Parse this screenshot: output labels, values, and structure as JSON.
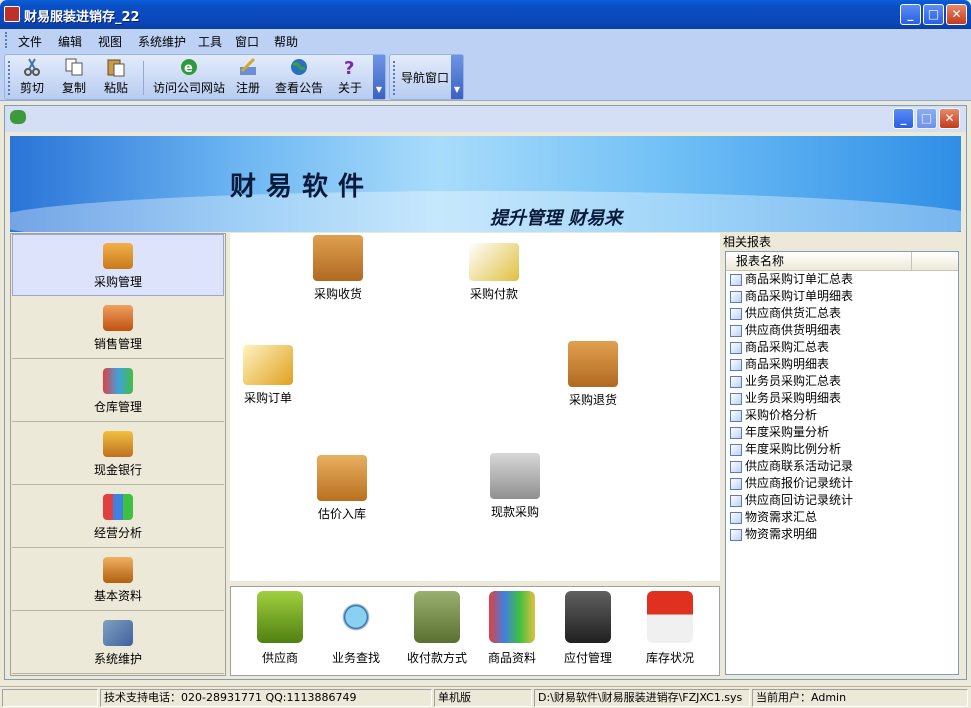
{
  "window": {
    "title": "财易服装进销存_22"
  },
  "menu": [
    "文件",
    "编辑",
    "视图",
    "系统维护",
    "工具",
    "窗口",
    "帮助"
  ],
  "toolbar": {
    "cut": "剪切",
    "copy": "复制",
    "paste": "粘贴",
    "visit_site": "访问公司网站",
    "register": "注册",
    "notice": "查看公告",
    "about": "关于",
    "nav_window": "导航窗口"
  },
  "banner": {
    "title": "财易软件",
    "slogan": "提升管理 财易来"
  },
  "nav": [
    "采购管理",
    "销售管理",
    "仓库管理",
    "现金银行",
    "经营分析",
    "基本资料",
    "系统维护"
  ],
  "functions": {
    "purchase_receive": "采购收货",
    "purchase_payment": "采购付款",
    "purchase_order": "采购订单",
    "purchase_return": "采购退货",
    "estimate_stock_in": "估价入库",
    "cash_purchase": "现款采购"
  },
  "quick": [
    "供应商",
    "业务查找",
    "收付款方式",
    "商品资料",
    "应付管理",
    "库存状况"
  ],
  "reports": {
    "header": "相关报表",
    "column": "报表名称",
    "items": [
      "商品采购订单汇总表",
      "商品采购订单明细表",
      "供应商供货汇总表",
      "供应商供货明细表",
      "商品采购汇总表",
      "商品采购明细表",
      "业务员采购汇总表",
      "业务员采购明细表",
      "采购价格分析",
      "年度采购量分析",
      "年度采购比例分析",
      "供应商联系活动记录",
      "供应商报价记录统计",
      "供应商回访记录统计",
      "物资需求汇总",
      "物资需求明细"
    ]
  },
  "status": {
    "support": "技术支持电话：020-28931771 QQ:1113886749",
    "edition": "单机版",
    "path": "D:\\财易软件\\财易服装进销存\\FZJXC1.sys",
    "user": "当前用户：Admin"
  }
}
